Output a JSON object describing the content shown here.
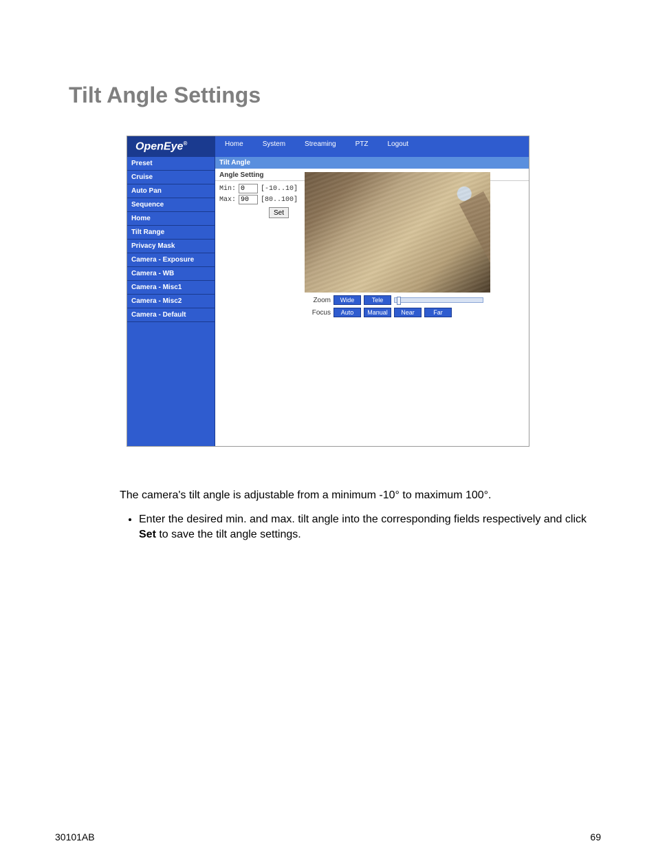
{
  "page": {
    "title": "Tilt Angle Settings"
  },
  "screenshot": {
    "logo": "OpenEye",
    "nav": [
      "Home",
      "System",
      "Streaming",
      "PTZ",
      "Logout"
    ],
    "sidebar": [
      "Preset",
      "Cruise",
      "Auto Pan",
      "Sequence",
      "Home",
      "Tilt Range",
      "Privacy Mask",
      "Camera - Exposure",
      "Camera - WB",
      "Camera - Misc1",
      "Camera - Misc2",
      "Camera - Default"
    ],
    "content_header": "Tilt Angle",
    "section_title": "Angle Setting",
    "min_label": "Min:",
    "min_value": "0",
    "min_range": "[-10..10]",
    "max_label": "Max:",
    "max_value": "90",
    "max_range": "[80..100]",
    "set_label": "Set",
    "zoom_label": "Zoom",
    "focus_label": "Focus",
    "zoom_buttons": [
      "Wide",
      "Tele"
    ],
    "focus_buttons": [
      "Auto",
      "Manual",
      "Near",
      "Far"
    ]
  },
  "body": {
    "paragraph": "The camera's tilt angle is adjustable from a minimum -10° to maximum 100°.",
    "bullet_prefix": "Enter the desired min. and max. tilt angle into the corresponding fields respectively and click ",
    "bullet_bold": "Set",
    "bullet_suffix": " to save the tilt angle settings."
  },
  "footer": {
    "doc_id": "30101AB",
    "page_num": "69"
  }
}
